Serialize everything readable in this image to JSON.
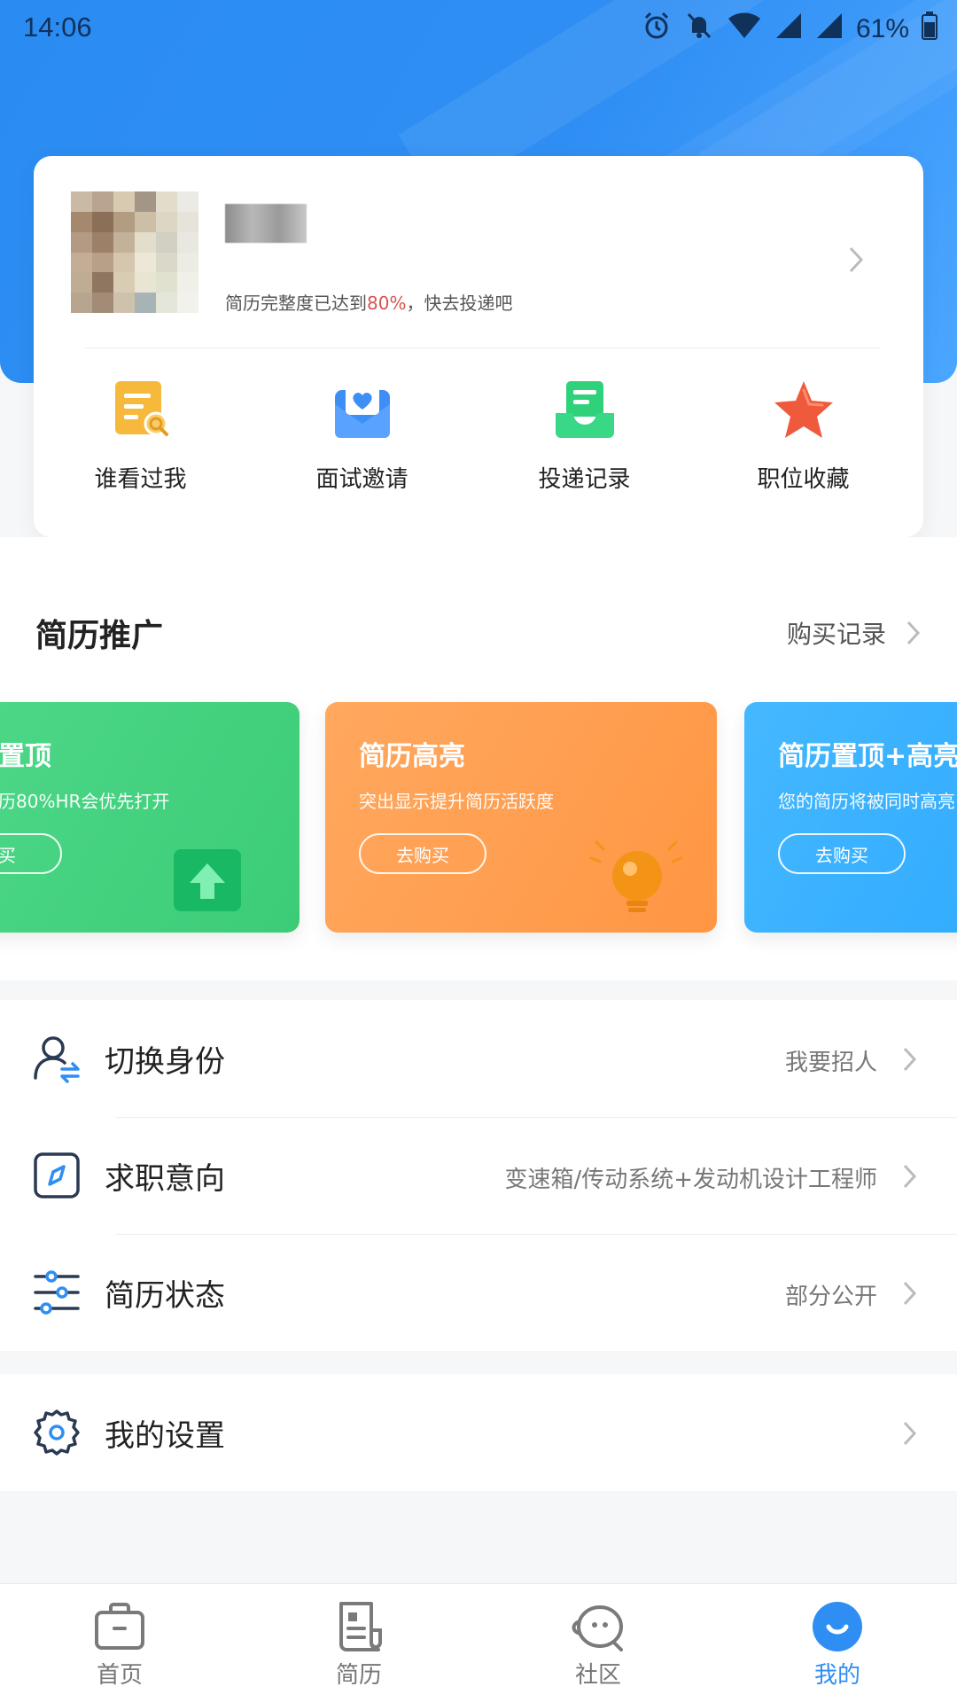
{
  "status_bar": {
    "time": "14:06",
    "battery": "61%",
    "icons": [
      "alarm-icon",
      "bell-off-icon",
      "wifi-icon",
      "signal-icon",
      "signal-icon",
      "battery-icon"
    ]
  },
  "profile": {
    "completeness_prefix": "简历完整度已达到",
    "completeness_value": "80%",
    "completeness_suffix": "，快去投递吧"
  },
  "quick_actions": [
    {
      "label": "谁看过我",
      "icon": "viewed-me-icon",
      "color": "#f6b93b"
    },
    {
      "label": "面试邀请",
      "icon": "interview-invite-icon",
      "color": "#3d8ff6"
    },
    {
      "label": "投递记录",
      "icon": "delivery-record-icon",
      "color": "#2fd17b"
    },
    {
      "label": "职位收藏",
      "icon": "star-icon",
      "color": "#f05a3c"
    }
  ],
  "promotion": {
    "title": "简历推广",
    "link": "购买记录",
    "cards": [
      {
        "title": "置顶",
        "desc": "历80%HR会优先打开",
        "button": "购买"
      },
      {
        "title": "简历高亮",
        "desc": "突出显示提升简历活跃度",
        "button": "去购买"
      },
      {
        "title": "简历置顶+高亮",
        "desc": "您的简历将被同时高亮",
        "button": "去购买"
      }
    ]
  },
  "menu": [
    {
      "title": "切换身份",
      "value": "我要招人",
      "icon": "switch-identity-icon"
    },
    {
      "title": "求职意向",
      "value": "变速箱/传动系统+发动机设计工程师",
      "icon": "compass-icon"
    },
    {
      "title": "简历状态",
      "value": "部分公开",
      "icon": "sliders-icon"
    },
    {
      "title": "我的设置",
      "value": "",
      "icon": "gear-icon"
    }
  ],
  "bottom_nav": [
    {
      "label": "首页",
      "icon": "home-briefcase-icon",
      "active": false
    },
    {
      "label": "简历",
      "icon": "resume-icon",
      "active": false
    },
    {
      "label": "社区",
      "icon": "community-icon",
      "active": false
    },
    {
      "label": "我的",
      "icon": "profile-smile-icon",
      "active": true
    }
  ],
  "colors": {
    "brand_blue": "#2f8ef4",
    "highlight_red": "#d9534f",
    "promo_green": "#3ccc77",
    "promo_orange": "#ff9643",
    "promo_blue": "#2aa7ff"
  }
}
